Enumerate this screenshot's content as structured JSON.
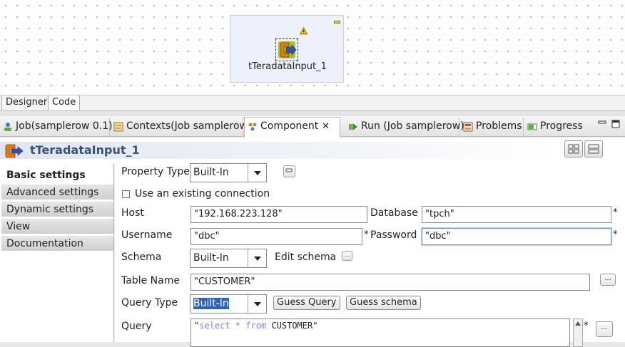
{
  "designer": {
    "component_label": "tTeradataInput_1",
    "tabs": [
      {
        "label": "Designer"
      },
      {
        "label": "Code"
      }
    ]
  },
  "view_tabs": [
    {
      "label": "Job(samplerow 0.1)",
      "icon": "job-icon"
    },
    {
      "label": "Contexts(Job samplerow",
      "icon": "contexts-icon"
    },
    {
      "label": "Component",
      "icon": "component-icon",
      "active": true
    },
    {
      "label": "Run (Job samplerow)",
      "icon": "run-icon"
    },
    {
      "label": "Problems",
      "icon": "problems-icon"
    },
    {
      "label": "Progress",
      "icon": "progress-icon"
    }
  ],
  "component": {
    "title": "tTeradataInput_1"
  },
  "nav": [
    {
      "label": "Basic settings",
      "active": true
    },
    {
      "label": "Advanced settings"
    },
    {
      "label": "Dynamic settings"
    },
    {
      "label": "View"
    },
    {
      "label": "Documentation"
    }
  ],
  "form": {
    "property_type": {
      "label": "Property Type",
      "value": "Built-In"
    },
    "existing_connection": {
      "label": "Use an existing connection",
      "checked": false
    },
    "host": {
      "label": "Host",
      "value": "\"192.168.223.128\""
    },
    "database": {
      "label": "Database",
      "value": "\"tpch\""
    },
    "username": {
      "label": "Username",
      "value": "\"dbc\""
    },
    "password": {
      "label": "Password",
      "value": "\"dbc\""
    },
    "schema": {
      "label": "Schema",
      "value": "Built-In",
      "edit_label": "Edit schema"
    },
    "table_name": {
      "label": "Table Name",
      "value": "\"CUSTOMER\""
    },
    "query_type": {
      "label": "Query Type",
      "value": "Built-In",
      "guess_query": "Guess Query",
      "guess_schema": "Guess schema"
    },
    "query": {
      "label": "Query",
      "kw1": "select",
      "star": "*",
      "kw2": "from",
      "table": "CUSTOMER"
    },
    "required_mark": "*",
    "ellipsis": "..."
  },
  "colors": {
    "accent": "#2f62b6",
    "title": "#3d4f74"
  }
}
